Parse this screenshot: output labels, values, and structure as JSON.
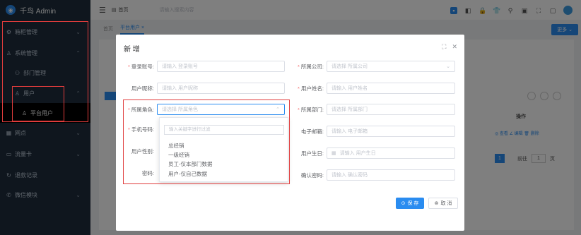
{
  "app": {
    "name": "千鸟 Admin"
  },
  "sidebar": {
    "items": [
      {
        "label": "箱柜管理"
      },
      {
        "label": "系统管理"
      },
      {
        "label": "部门管理"
      },
      {
        "label": "用户"
      },
      {
        "label": "平台用户"
      },
      {
        "label": "网点"
      },
      {
        "label": "流量卡"
      },
      {
        "label": "退款记录"
      },
      {
        "label": "微信模块"
      }
    ]
  },
  "header": {
    "crumb": "首页",
    "search_placeholder": "请输入搜索内容"
  },
  "tabs": [
    {
      "label": "首页"
    },
    {
      "label": "平台用户 ×"
    }
  ],
  "more_label": "更多 ⌄",
  "background": {
    "actions_header": "操作",
    "row_actions": "◎ 查看  ∠ 编辑  🗑 删除",
    "pager_page": "1",
    "pager_goto": "前往",
    "pager_input": "1",
    "pager_unit": "页"
  },
  "dialog": {
    "title": "新 增",
    "fields": {
      "account": {
        "label": "登录账号:",
        "placeholder": "请输入 登录账号"
      },
      "company": {
        "label": "所属公司:",
        "placeholder": "请选择 所属公司"
      },
      "nickname": {
        "label": "用户昵称:",
        "placeholder": "请输入 用户昵称"
      },
      "realname": {
        "label": "用户姓名:",
        "placeholder": "请输入 用户姓名"
      },
      "role": {
        "label": "所属角色:",
        "placeholder": "请选择 所属角色"
      },
      "dept": {
        "label": "所属部门:",
        "placeholder": "请选择 所属部门"
      },
      "phone": {
        "label": "手机号码:"
      },
      "email": {
        "label": "电子邮箱:",
        "placeholder": "请输入 电子邮箱"
      },
      "gender": {
        "label": "用户性别:"
      },
      "birthday": {
        "label": "用户生日:",
        "placeholder": "请输入 用户生日"
      },
      "password": {
        "label": "密码:"
      },
      "confirm": {
        "label": "确认密码:",
        "placeholder": "请输入 确认密码"
      }
    },
    "dropdown": {
      "search_placeholder": "输入关键字进行过滤",
      "options": [
        "总经销",
        "一级经销",
        "员工-仅本部门数据",
        "用户-仅自己数据"
      ]
    },
    "save_label": "保 存",
    "cancel_label": "取 消"
  }
}
